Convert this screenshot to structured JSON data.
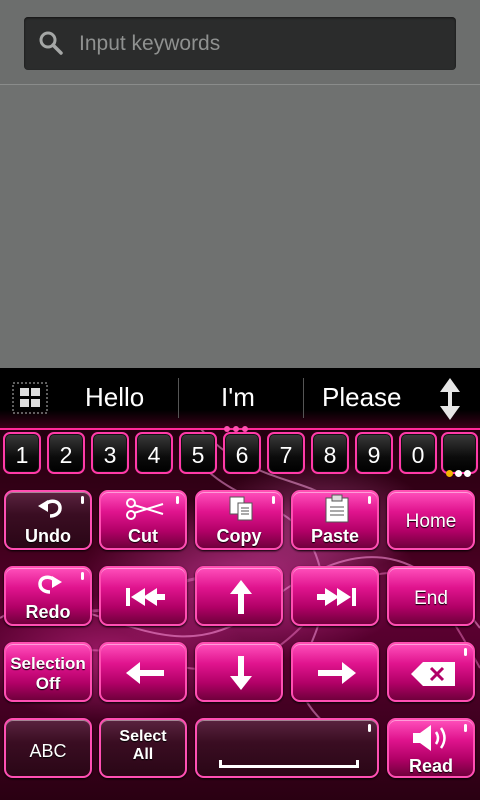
{
  "search": {
    "placeholder": "Input keywords",
    "icon": "search-icon"
  },
  "keyboard": {
    "accent": "#ff2a9a",
    "suggestions": [
      "Hello",
      "I'm",
      "Please"
    ],
    "numbers": [
      "1",
      "2",
      "3",
      "4",
      "5",
      "6",
      "7",
      "8",
      "9",
      "0"
    ],
    "keys": {
      "undo": "Undo",
      "cut": "Cut",
      "copy": "Copy",
      "paste": "Paste",
      "home": "Home",
      "redo": "Redo",
      "end": "End",
      "selection_off_1": "Selection",
      "selection_off_2": "Off",
      "abc": "ABC",
      "select_all_1": "Select",
      "select_all_2": "All",
      "read": "Read"
    }
  }
}
